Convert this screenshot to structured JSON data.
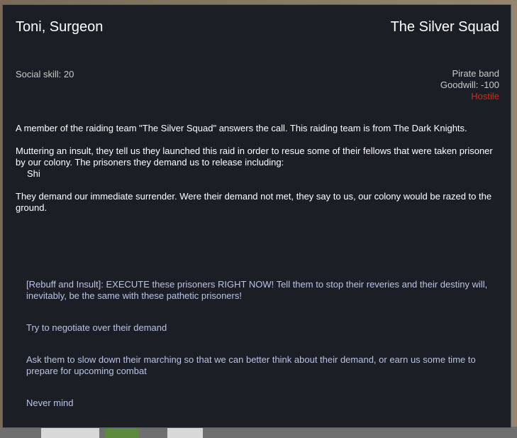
{
  "header": {
    "speaker": "Toni, Surgeon",
    "faction": "The Silver Squad"
  },
  "stats": {
    "social_skill": "Social skill: 20",
    "faction_type": "Pirate band",
    "goodwill": "Goodwill: -100",
    "relation": "Hostile"
  },
  "message": {
    "para1": "A member of the raiding team \"The Silver Squad\" answers the call. This raiding team is from The Dark Knights.",
    "para2": "Muttering an insult, they tell us they launched this raid in order to resue some of their fellows that were taken prisoner by our colony. The prisoners they demand us to release including:",
    "prisoner": "Shi",
    "para3": "They demand our immediate surrender. Were their demand not met, they say to us, our colony would be razed to the ground."
  },
  "options": [
    "[Rebuff and Insult]: EXECUTE these prisoners RIGHT NOW! Tell them to stop their reveries and their destiny will, inevitably, be the same with these pathetic prisoners!",
    "Try to negotiate over their demand",
    "Ask them to slow down their marching so that we can better think about their demand, or earn us some time to prepare for upcoming combat",
    "Never mind"
  ],
  "colors": {
    "panel_bg": "#1b1f25",
    "title_text": "#ffffff",
    "option_text": "#b9c3e6",
    "hostile": "#e32020"
  }
}
